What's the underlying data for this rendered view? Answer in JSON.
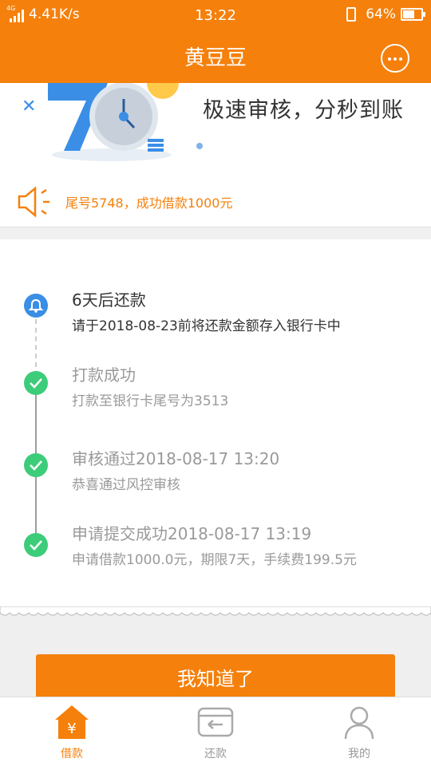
{
  "status_bar": {
    "network": "4G",
    "speed": "4.41K/s",
    "time": "13:22",
    "battery": "64%",
    "battery_level": 0.64
  },
  "header": {
    "title": "黄豆豆",
    "more_icon": "more-dots-icon"
  },
  "banner": {
    "slogan": "极速审核，分秒到账",
    "notice": "尾号5748，成功借款1000元",
    "notice_icon": "speaker-icon"
  },
  "timeline": [
    {
      "title": "6天后还款",
      "desc": "请于2018-08-23前将还款金额存入银行卡中",
      "icon": "bell-icon",
      "active": true
    },
    {
      "title": "打款成功",
      "desc": "打款至银行卡尾号为3513",
      "icon": "check-icon",
      "active": false
    },
    {
      "title": "审核通过2018-08-17 13:20",
      "desc": "恭喜通过风控审核",
      "icon": "check-icon",
      "active": false
    },
    {
      "title": "申请提交成功2018-08-17 13:19",
      "desc": "申请借款1000.0元，期限7天，手续费199.5元",
      "icon": "check-icon",
      "active": false
    }
  ],
  "confirm_button": "我知道了",
  "tabs": [
    {
      "label": "借款",
      "icon": "borrow-icon",
      "active": true
    },
    {
      "label": "还款",
      "icon": "repay-icon",
      "active": false
    },
    {
      "label": "我的",
      "icon": "profile-icon",
      "active": false
    }
  ],
  "colors": {
    "brand": "#f5800c",
    "bell": "#3a8ee6",
    "check": "#3dcc7a"
  }
}
